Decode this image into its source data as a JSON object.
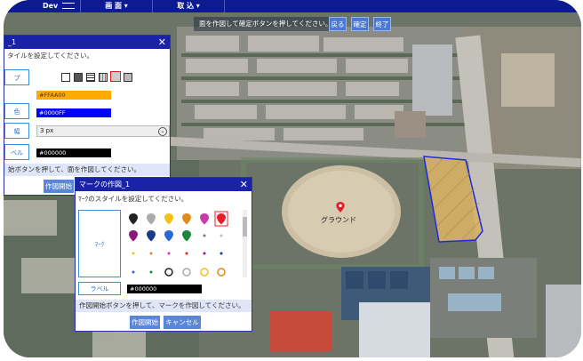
{
  "app": {
    "logo_text": "Dev"
  },
  "menu": {
    "items": [
      "画 面 ▾",
      "取 込 ▾"
    ]
  },
  "toolbar": {
    "instruction": "面を作図して確定ボタンを押してください。",
    "buttons": [
      "戻る",
      "確定",
      "終了"
    ]
  },
  "panel_left": {
    "title": "_1",
    "subtitle": "タイルを設定してください。",
    "labels": [
      "プ",
      "色",
      "幅",
      "ベル"
    ],
    "fill_color_value": "#FFAA00",
    "line_color_value": "#0000FF",
    "line_width_value": "3 px",
    "label_color_value": "#000000",
    "footer_text": "始ボタンを押して、面を作図してください。",
    "start_button": "作図開始"
  },
  "panel_mark": {
    "title": "マークの作図_1",
    "subtitle": "ﾏｰｸのスタイルを設定してください。",
    "mark_label": "ﾏｰｸ",
    "label_label": "ラベル",
    "label_color_value": "#000000",
    "footer_text": "作図開始ボタンを押して、マークを作図してください。",
    "start_button": "作図開始",
    "cancel_button": "キャンセル"
  },
  "map": {
    "ground_label": "グラウンド"
  },
  "colors": {
    "header_blue": "#1a23a8",
    "orange": "#FFAA00",
    "blue": "#0000FF",
    "pin_red": "#e0202a"
  }
}
